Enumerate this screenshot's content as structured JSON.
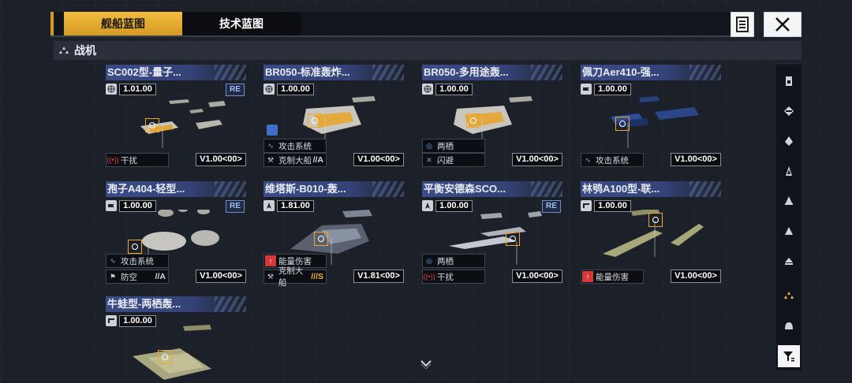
{
  "tabs": [
    {
      "label": "舰船蓝图",
      "active": true
    },
    {
      "label": "技术蓝图",
      "active": false
    }
  ],
  "header_icons": {
    "notes": "notes-icon",
    "close": "close-icon"
  },
  "section": {
    "icon": "fighter-class-icon",
    "label": "战机"
  },
  "cards": [
    {
      "title": "SC002型-量子...",
      "cost_icon": "globe-icon",
      "cost": "1.01.00",
      "re": "RE",
      "traits": [
        {
          "icon": "interference-icon",
          "label": "干扰",
          "grade": ""
        }
      ],
      "version": "V1.00<00>"
    },
    {
      "title": "BR050-标准轰炸...",
      "cost_icon": "globe-icon",
      "cost": "1.00.00",
      "re": "",
      "traits": [
        {
          "icon": "attack-system-icon",
          "label": "攻击系统",
          "grade": ""
        },
        {
          "icon": "anti-capital-icon",
          "label": "克制大船",
          "grade": "//A"
        }
      ],
      "version": "V1.00<00>"
    },
    {
      "title": "BR050-多用途轰...",
      "cost_icon": "globe-icon",
      "cost": "1.00.00",
      "re": "",
      "traits": [
        {
          "icon": "amphibious-icon",
          "label": "两栖",
          "grade": ""
        },
        {
          "icon": "evade-icon",
          "label": "闪避",
          "grade": ""
        }
      ],
      "version": "V1.00<00>"
    },
    {
      "title": "佩刀Aer410-强...",
      "cost_icon": "faction-icon",
      "cost": "1.00.00",
      "re": "",
      "traits": [
        {
          "icon": "attack-system-icon",
          "label": "攻击系统",
          "grade": ""
        }
      ],
      "version": "V1.00<00>"
    },
    {
      "title": "孢子A404-轻型...",
      "cost_icon": "faction-icon",
      "cost": "1.00.00",
      "re": "RE",
      "traits": [
        {
          "icon": "attack-system-icon",
          "label": "攻击系统",
          "grade": ""
        },
        {
          "icon": "anti-air-icon",
          "label": "防空",
          "grade": "//A"
        }
      ],
      "version": "V1.00<00>"
    },
    {
      "title": "维塔斯-B010-轰...",
      "cost_icon": "faction-icon",
      "cost": "1.81.00",
      "re": "",
      "traits": [
        {
          "icon": "energy-damage-icon",
          "label": "能量伤害",
          "grade": ""
        },
        {
          "icon": "anti-capital-icon",
          "label": "克制大船",
          "grade": "///S"
        }
      ],
      "version": "V1.81<00>"
    },
    {
      "title": "平衡安德森SCO...",
      "cost_icon": "faction-icon",
      "cost": "1.00.00",
      "re": "RE",
      "traits": [
        {
          "icon": "amphibious-icon",
          "label": "两栖",
          "grade": ""
        },
        {
          "icon": "interference-icon",
          "label": "干扰",
          "grade": ""
        }
      ],
      "version": "V1.00<00>"
    },
    {
      "title": "林鸮A100型-联...",
      "cost_icon": "faction-icon",
      "cost": "1.00.00",
      "re": "",
      "traits": [
        {
          "icon": "energy-damage-icon",
          "label": "能量伤害",
          "grade": ""
        }
      ],
      "version": "V1.00<00>"
    },
    {
      "title": "牛蛙型-两栖轰...",
      "cost_icon": "faction-icon",
      "cost": "1.00.00",
      "re": "",
      "traits": [],
      "version": ""
    }
  ],
  "sidebar": [
    {
      "icon": "carrier-class-icon"
    },
    {
      "icon": "battlecruiser-class-icon"
    },
    {
      "icon": "cruiser-class-icon"
    },
    {
      "icon": "destroyer-class-icon"
    },
    {
      "icon": "frigate-class-icon"
    },
    {
      "icon": "corvette-class-icon"
    },
    {
      "icon": "support-class-icon"
    },
    {
      "icon": "fighter-class-icon",
      "active": true
    },
    {
      "icon": "all-class-icon"
    }
  ],
  "colors": {
    "accent": "#f0b43a",
    "title_bar": "#3b4b86",
    "danger": "#d43a3a",
    "info": "#5a8fe0"
  }
}
